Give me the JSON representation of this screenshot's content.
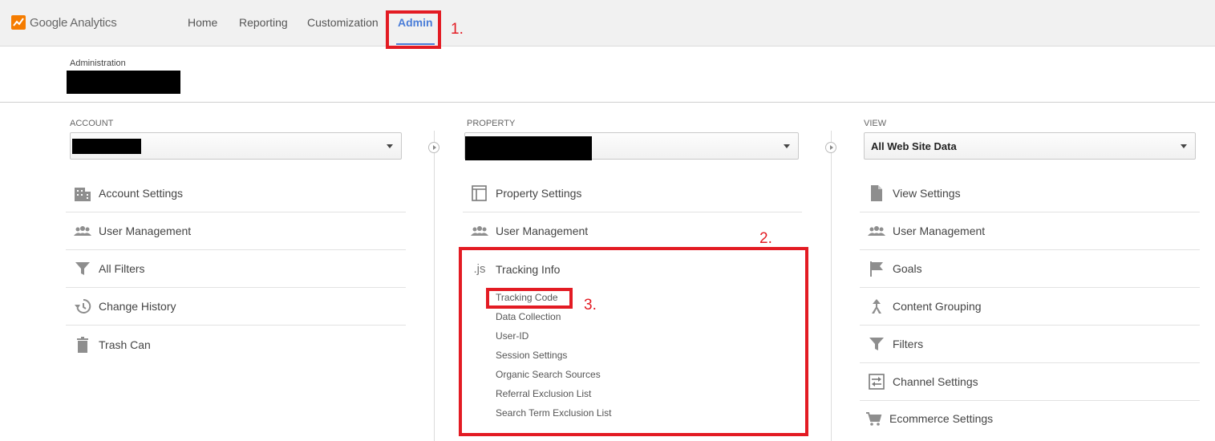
{
  "app": {
    "name": "Google Analytics"
  },
  "nav": [
    {
      "label": "Home"
    },
    {
      "label": "Reporting"
    },
    {
      "label": "Customization"
    },
    {
      "label": "Admin"
    }
  ],
  "header": {
    "admin_label": "Administration"
  },
  "account": {
    "label": "ACCOUNT",
    "items": [
      {
        "label": "Account Settings",
        "icon": "building-icon"
      },
      {
        "label": "User Management",
        "icon": "users-icon"
      },
      {
        "label": "All Filters",
        "icon": "filter-icon"
      },
      {
        "label": "Change History",
        "icon": "history-icon"
      },
      {
        "label": "Trash Can",
        "icon": "trash-icon"
      }
    ]
  },
  "property": {
    "label": "PROPERTY",
    "items": [
      {
        "label": "Property Settings",
        "icon": "layout-icon"
      },
      {
        "label": "User Management",
        "icon": "users-icon"
      },
      {
        "label": "Tracking Info",
        "icon": "js-icon",
        "glyph": ".js"
      }
    ],
    "tracking_sub": [
      "Tracking Code",
      "Data Collection",
      "User-ID",
      "Session Settings",
      "Organic Search Sources",
      "Referral Exclusion List",
      "Search Term Exclusion List"
    ]
  },
  "view": {
    "label": "VIEW",
    "selected": "All Web Site Data",
    "items": [
      {
        "label": "View Settings",
        "icon": "document-icon"
      },
      {
        "label": "User Management",
        "icon": "users-icon"
      },
      {
        "label": "Goals",
        "icon": "flag-icon"
      },
      {
        "label": "Content Grouping",
        "icon": "grouping-icon"
      },
      {
        "label": "Filters",
        "icon": "filter-icon"
      },
      {
        "label": "Channel Settings",
        "icon": "channel-icon"
      },
      {
        "label": "Ecommerce Settings",
        "icon": "cart-icon"
      }
    ]
  },
  "annotations": {
    "one": "1.",
    "two": "2.",
    "three": "3."
  },
  "colors": {
    "accent": "#4a7dd8",
    "annotation": "#e31b23",
    "logo": "#f57c00"
  }
}
